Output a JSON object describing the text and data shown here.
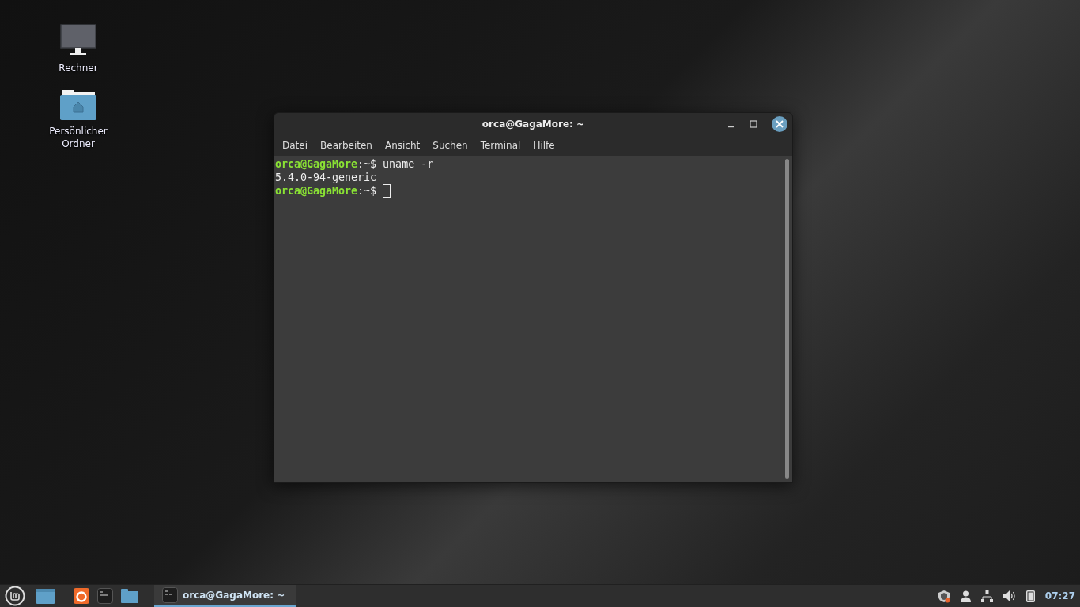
{
  "desktop_icons": [
    {
      "kind": "computer",
      "label": "Rechner"
    },
    {
      "kind": "home-folder",
      "label": "Persönlicher Ordner"
    }
  ],
  "window": {
    "title": "orca@GagaMore: ~",
    "menu": [
      "Datei",
      "Bearbeiten",
      "Ansicht",
      "Suchen",
      "Terminal",
      "Hilfe"
    ],
    "lines": [
      {
        "kind": "prompt",
        "user_host": "orca@GagaMore",
        "path_sign": ":~$",
        "command": "uname -r"
      },
      {
        "kind": "output",
        "text": "5.4.0-94-generic"
      },
      {
        "kind": "prompt",
        "user_host": "orca@GagaMore",
        "path_sign": ":~$",
        "cursor": true
      }
    ]
  },
  "taskbar": {
    "launchers": [
      {
        "kind": "desktop"
      },
      {
        "kind": "firefox"
      },
      {
        "kind": "terminal"
      },
      {
        "kind": "files"
      }
    ],
    "windows": [
      {
        "title": "orca@GagaMore: ~",
        "selected": true
      }
    ],
    "clock": "07:27"
  }
}
